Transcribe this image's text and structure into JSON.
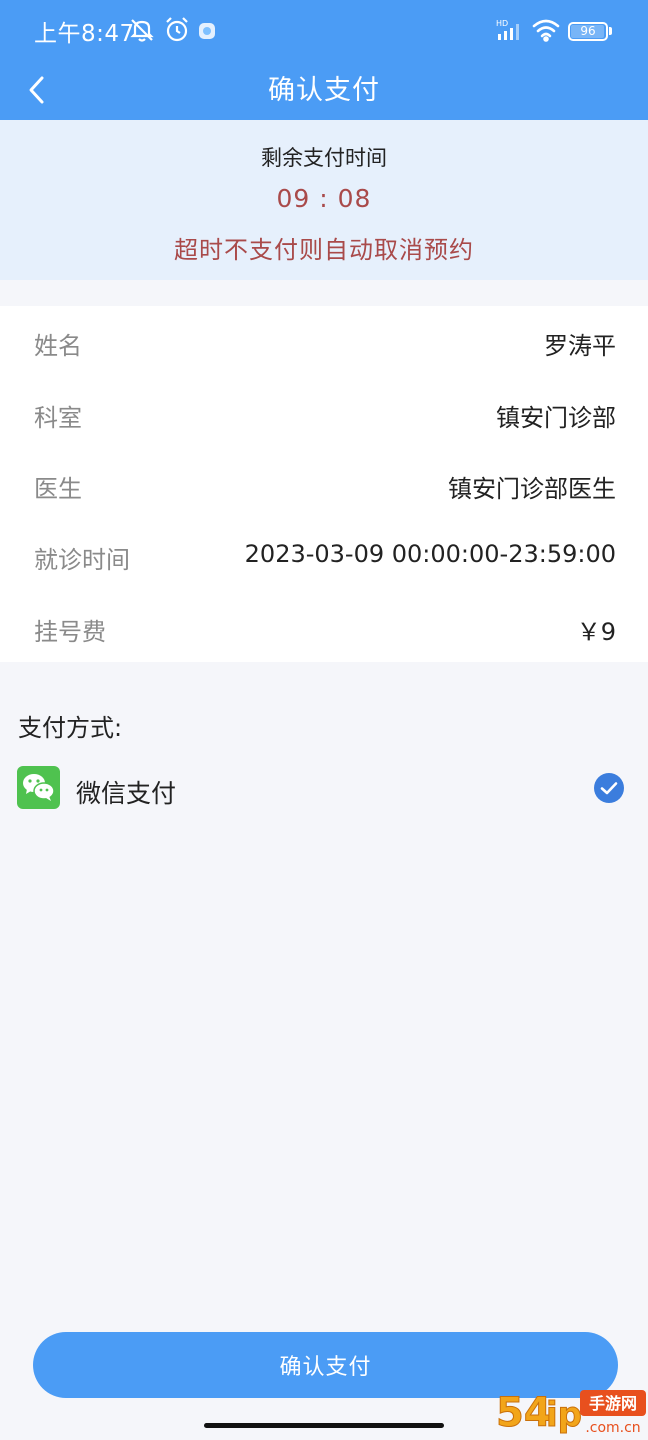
{
  "status_bar": {
    "time": "上午8:47",
    "battery": "96",
    "signal_label": "HD"
  },
  "nav": {
    "title": "确认支付"
  },
  "countdown": {
    "label": "剩余支付时间",
    "time": "09 : 08",
    "warning": "超时不支付则自动取消预约"
  },
  "info": {
    "rows": [
      {
        "key": "姓名",
        "value": "罗涛平"
      },
      {
        "key": "科室",
        "value": "镇安门诊部"
      },
      {
        "key": "医生",
        "value": "镇安门诊部医生"
      },
      {
        "key": "就诊时间",
        "value": "2023-03-09 00:00:00-23:59:00"
      },
      {
        "key": "挂号费",
        "value": "￥9"
      }
    ]
  },
  "payment": {
    "heading": "支付方式:",
    "method_label": "微信支付",
    "selected": true
  },
  "confirm_button": "确认支付",
  "watermark": {
    "logo_text": "54ip手游网",
    "domain": ".com.cn"
  },
  "colors": {
    "primary": "#4b9cf5",
    "countdown_bg": "#e6f0fc",
    "warning_text": "#a94a4a",
    "wechat_green": "#4fc24f",
    "check_blue": "#3b7ddd"
  }
}
